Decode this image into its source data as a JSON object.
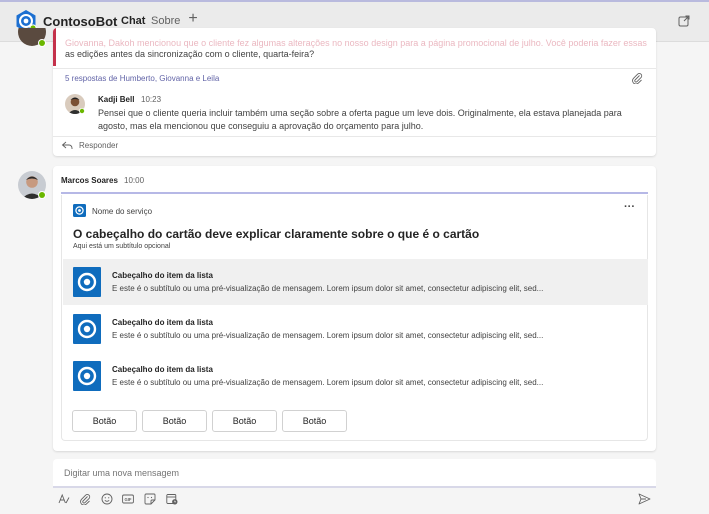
{
  "header": {
    "app_name": "ContosoBot",
    "tabs": [
      {
        "label": "Chat",
        "active": true
      },
      {
        "label": "Sobre",
        "active": false
      }
    ],
    "add_tab_icon": "plus-icon",
    "popout_icon": "popout-icon"
  },
  "thread": {
    "cut_text": "Giovanna, Dakoh mencionou que o cliente fez algumas alterações no nosso design para a página promocional de julho. Você poderia fazer essas",
    "edit_text": "as edições antes da sincronização com o cliente, quarta-feira?",
    "replies_link": "5 respostas de Humberto, Giovanna e Leila",
    "reply": {
      "author": "Kadji Bell",
      "time": "10:23",
      "line1": "Pensei que o cliente queria incluir também uma seção sobre a oferta pague um leve dois. Originalmente, ela estava planejada para",
      "line2": "agosto, mas ela mencionou que conseguiu a aprovação do orçamento para julho."
    },
    "reply_button": "Responder"
  },
  "message": {
    "author": "Marcos Soares",
    "time": "10:00",
    "card": {
      "service_name": "Nome do serviço",
      "title": "O cabeçalho do cartão deve explicar claramente sobre o que é o cartão",
      "subtitle": "Aqui está um subtítulo opcional",
      "items": [
        {
          "heading": "Cabeçalho do item da lista",
          "subtitle": "E este é o subtítulo ou uma pré-visualização de mensagem. Lorem ipsum dolor sit amet, consectetur adipiscing elit, sed..."
        },
        {
          "heading": "Cabeçalho do item da lista",
          "subtitle": "E este é o subtítulo ou uma pré-visualização de mensagem. Lorem ipsum dolor sit amet, consectetur adipiscing elit, sed..."
        },
        {
          "heading": "Cabeçalho do item da lista",
          "subtitle": "E este é o subtítulo ou uma pré-visualização de mensagem. Lorem ipsum dolor sit amet, consectetur adipiscing elit, sed..."
        }
      ],
      "buttons": [
        "Botão",
        "Botão",
        "Botão",
        "Botão"
      ]
    }
  },
  "compose": {
    "placeholder": "Digitar uma nova mensagem",
    "tools": [
      "format-icon",
      "attach-icon",
      "emoji-icon",
      "gif-icon",
      "sticker-icon",
      "schedule-meeting-icon"
    ],
    "send_icon": "send-icon"
  },
  "colors": {
    "brand": "#5b5fc7",
    "link": "#6264a7",
    "presence_available": "#6bb700",
    "important": "#c4314b",
    "app_icon": "#0f6cbd"
  }
}
